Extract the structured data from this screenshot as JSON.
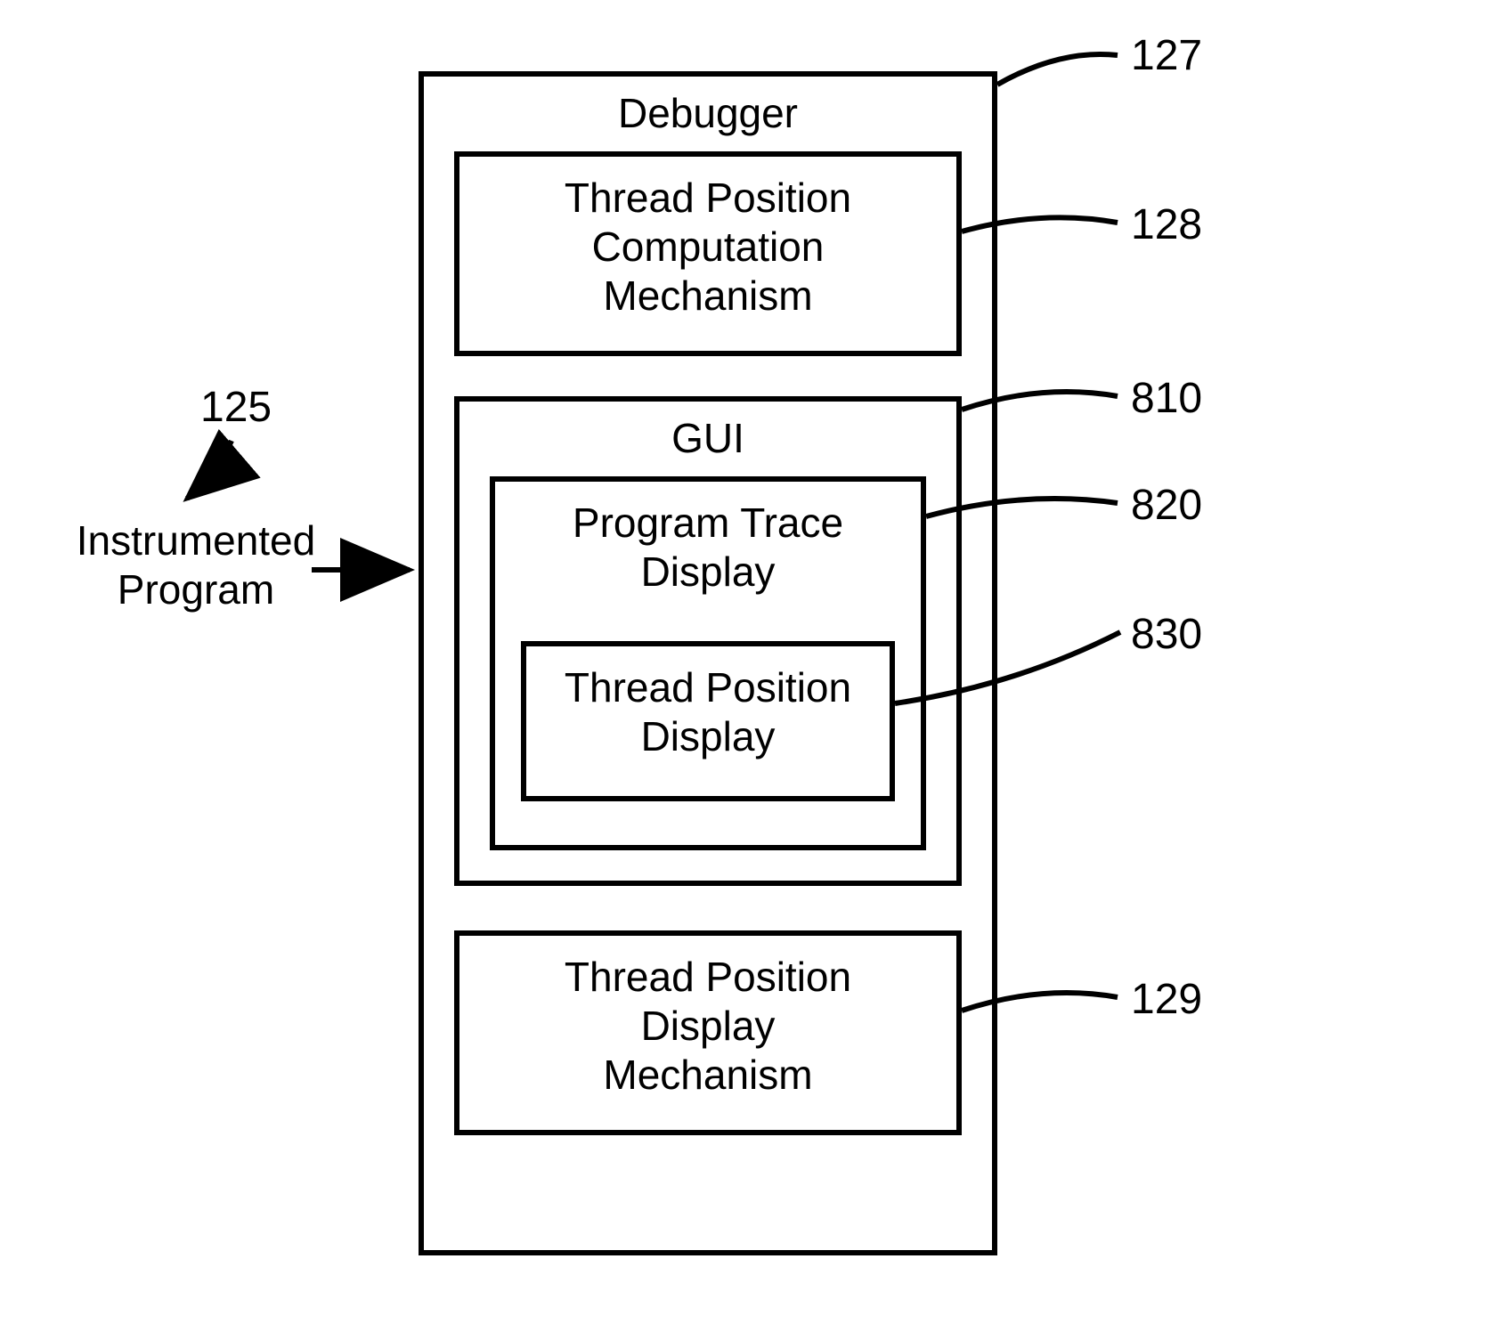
{
  "chart_data": {
    "type": "diagram",
    "nodes": [
      {
        "id": "125",
        "label": "Instrumented Program",
        "ref": "125"
      },
      {
        "id": "127",
        "label": "Debugger",
        "ref": "127"
      },
      {
        "id": "128",
        "label": "Thread Position Computation Mechanism",
        "ref": "128",
        "parent": "127"
      },
      {
        "id": "810",
        "label": "GUI",
        "ref": "810",
        "parent": "127"
      },
      {
        "id": "820",
        "label": "Program Trace Display",
        "ref": "820",
        "parent": "810"
      },
      {
        "id": "830",
        "label": "Thread Position Display",
        "ref": "830",
        "parent": "820"
      },
      {
        "id": "129",
        "label": "Thread Position Display Mechanism",
        "ref": "129",
        "parent": "127"
      }
    ],
    "edges": [
      {
        "from": "125",
        "to": "127",
        "type": "arrow"
      }
    ]
  },
  "labels": {
    "instrumented_program": "Instrumented\nProgram",
    "debugger": "Debugger",
    "tpcm": "Thread Position\nComputation\nMechanism",
    "gui": "GUI",
    "ptd": "Program Trace\nDisplay",
    "tpd": "Thread Position\nDisplay",
    "tpdm": "Thread Position\nDisplay\nMechanism"
  },
  "refs": {
    "r125": "125",
    "r127": "127",
    "r128": "128",
    "r810": "810",
    "r820": "820",
    "r830": "830",
    "r129": "129"
  }
}
